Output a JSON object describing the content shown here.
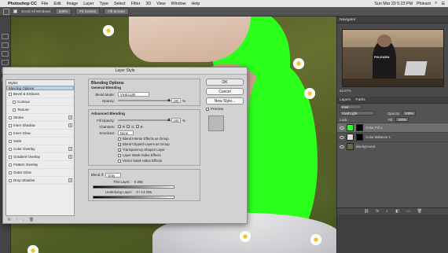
{
  "menubar": {
    "apple": "",
    "app": "Photoshop CC",
    "items": [
      "File",
      "Edit",
      "Image",
      "Layer",
      "Type",
      "Select",
      "Filter",
      "3D",
      "View",
      "Window",
      "Help"
    ],
    "datetime": "Sun Mar 20  5:23 PM",
    "user": "Phlearn"
  },
  "options_bar": {
    "scroll_all": "Scroll All Windows",
    "zoom": "100%",
    "fit": "Fit Screen",
    "fill": "Fill Screen"
  },
  "dialog": {
    "title": "Layer Style",
    "styles_header": "Styles",
    "styles": [
      {
        "label": "Blending Options",
        "checkbox": false,
        "plus": false,
        "selected": true,
        "sub": false
      },
      {
        "label": "Bevel & Emboss",
        "checkbox": true,
        "plus": false,
        "selected": false,
        "sub": false
      },
      {
        "label": "Contour",
        "checkbox": true,
        "plus": false,
        "selected": false,
        "sub": true
      },
      {
        "label": "Texture",
        "checkbox": true,
        "plus": false,
        "selected": false,
        "sub": true
      },
      {
        "label": "Stroke",
        "checkbox": true,
        "plus": true,
        "selected": false,
        "sub": false
      },
      {
        "label": "Inner Shadow",
        "checkbox": true,
        "plus": true,
        "selected": false,
        "sub": false
      },
      {
        "label": "Inner Glow",
        "checkbox": true,
        "plus": false,
        "selected": false,
        "sub": false
      },
      {
        "label": "Satin",
        "checkbox": true,
        "plus": false,
        "selected": false,
        "sub": false
      },
      {
        "label": "Color Overlay",
        "checkbox": true,
        "plus": true,
        "selected": false,
        "sub": false
      },
      {
        "label": "Gradient Overlay",
        "checkbox": true,
        "plus": true,
        "selected": false,
        "sub": false
      },
      {
        "label": "Pattern Overlay",
        "checkbox": true,
        "plus": false,
        "selected": false,
        "sub": false
      },
      {
        "label": "Outer Glow",
        "checkbox": true,
        "plus": false,
        "selected": false,
        "sub": false
      },
      {
        "label": "Drop Shadow",
        "checkbox": true,
        "plus": true,
        "selected": false,
        "sub": false
      }
    ],
    "footer_icons": [
      "fx",
      "↑",
      "↓",
      "🗑"
    ],
    "blending_options": {
      "title": "Blending Options",
      "general": "General Blending",
      "blend_mode_label": "Blend Mode:",
      "blend_mode": "Vivid Light",
      "opacity_label": "Opacity:",
      "opacity": "100",
      "pct": "%"
    },
    "advanced": {
      "title": "Advanced Blending",
      "fill_opacity_label": "Fill Opacity:",
      "fill_opacity": "100",
      "pct": "%",
      "channels_label": "Channels:",
      "channels": [
        "R",
        "G",
        "B"
      ],
      "knockout_label": "Knockout:",
      "knockout": "None",
      "checks": [
        {
          "label": "Blend Interior Effects as Group",
          "on": false
        },
        {
          "label": "Blend Clipped Layers as Group",
          "on": true
        },
        {
          "label": "Transparency Shapes Layer",
          "on": true
        },
        {
          "label": "Layer Mask Hides Effects",
          "on": false
        },
        {
          "label": "Vector Mask Hides Effects",
          "on": false
        }
      ]
    },
    "blend_if": {
      "label": "Blend If:",
      "value": "Gray",
      "this_layer_label": "This Layer:",
      "this_layer": "0          255",
      "underlying_label": "Underlying Layer:",
      "underlying": "0  /  13     255"
    },
    "buttons": {
      "ok": "OK",
      "cancel": "Cancel",
      "new_style": "New Style...",
      "preview": "Preview"
    }
  },
  "navigator": {
    "tab": "Navigator",
    "zoom": "66.67%",
    "shirt_text": "PHLEARN"
  },
  "layers": {
    "tabs": [
      "Layers",
      "Paths"
    ],
    "kind": "Kind",
    "blend_mode": "Vivid Light",
    "opacity_label": "Opacity:",
    "opacity": "100%",
    "lock_label": "Lock:",
    "fill_label": "Fill:",
    "fill": "100%",
    "items": [
      {
        "name": "Color Fill 1",
        "active": true,
        "thumb_color": "#2bff1c"
      },
      {
        "name": "Color Balance 1",
        "active": false,
        "thumb_color": "#d9d9d9"
      },
      {
        "name": "Background",
        "active": false,
        "thumb_color": "#6b6b3a"
      }
    ],
    "footer": [
      "⛓",
      "fx",
      "◐",
      "◧",
      "▭",
      "🗑"
    ]
  },
  "colors": {
    "green_fill": "#2bff1c",
    "selected_style": "#b9d3ef"
  }
}
